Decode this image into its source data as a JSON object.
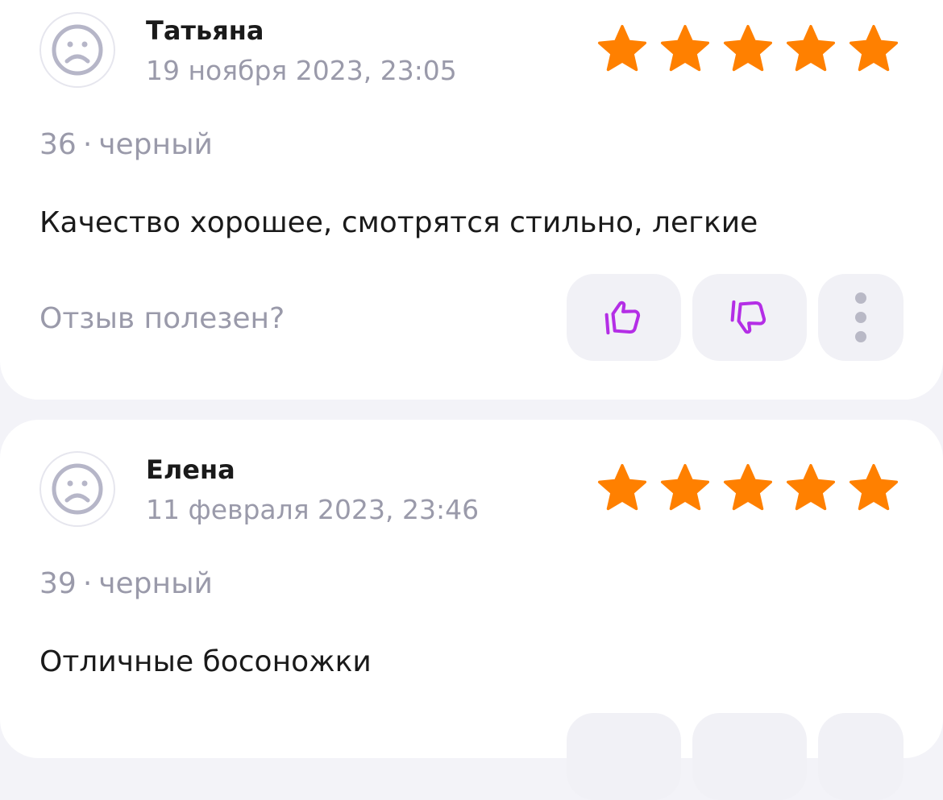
{
  "reviews": [
    {
      "author": "Татьяна",
      "date": "19 ноября 2023, 23:05",
      "rating": 5,
      "size": "36",
      "separator": "·",
      "color": "черный",
      "text": "Качество хорошее, смотрятся стильно, легкие",
      "helpful_prompt": "Отзыв полезен?"
    },
    {
      "author": "Елена",
      "date": "11 февраля 2023, 23:46",
      "rating": 5,
      "size": "39",
      "separator": "·",
      "color": "черный",
      "text": "Отличные босоножки"
    }
  ],
  "icons": {
    "avatar": "sad-face-icon",
    "star": "star-icon",
    "like": "thumbs-up-icon",
    "dislike": "thumbs-down-icon",
    "more": "more-vertical-icon"
  },
  "colors": {
    "star": "#ff8000",
    "vote_icon": "#b42ee6",
    "muted_text": "#9a9aaa",
    "button_bg": "#f1f1f6"
  }
}
